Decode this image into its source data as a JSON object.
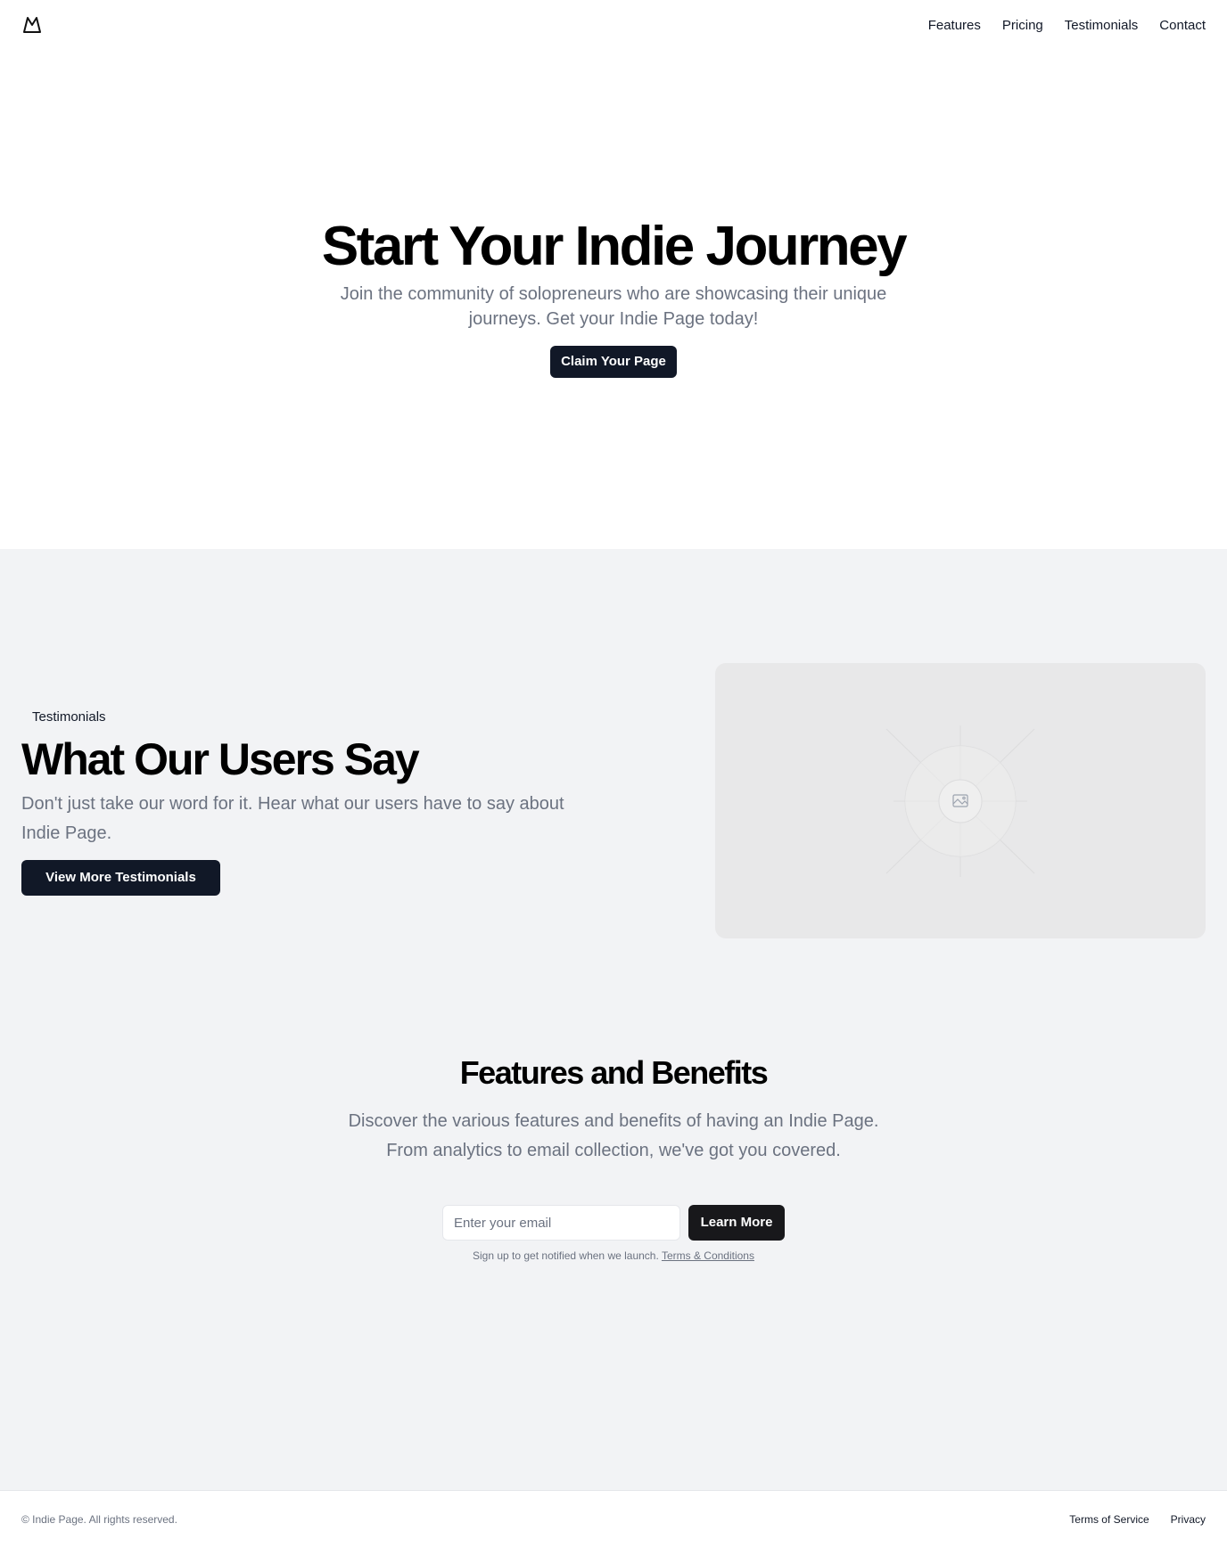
{
  "header": {
    "logo_icon": "mountain-logo-icon",
    "nav": [
      {
        "label": "Features"
      },
      {
        "label": "Pricing"
      },
      {
        "label": "Testimonials"
      },
      {
        "label": "Contact"
      }
    ]
  },
  "hero": {
    "title": "Start Your Indie Journey",
    "subtitle": "Join the community of solopreneurs who are showcasing their unique journeys. Get your Indie Page today!",
    "cta": "Claim Your Page"
  },
  "testimonials": {
    "tag": "Testimonials",
    "title": "What Our Users Say",
    "description": "Don't just take our word for it. Hear what our users have to say about Indie Page.",
    "cta": "View More Testimonials",
    "image_icon": "image-placeholder-icon"
  },
  "features": {
    "title": "Features and Benefits",
    "description": "Discover the various features and benefits of having an Indie Page. From analytics to email collection, we've got you covered.",
    "email_placeholder": "Enter your email",
    "cta": "Learn More",
    "note": "Sign up to get notified when we launch.",
    "note_link": "Terms & Conditions"
  },
  "footer": {
    "copyright": "© Indie Page. All rights reserved.",
    "links": [
      {
        "label": "Terms of Service"
      },
      {
        "label": "Privacy"
      }
    ]
  },
  "colors": {
    "primary_button": "#111827",
    "section_background": "#f2f3f5",
    "muted_text": "#6b7280"
  }
}
